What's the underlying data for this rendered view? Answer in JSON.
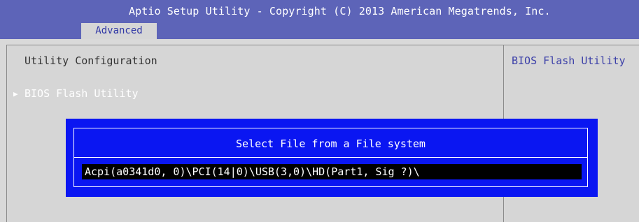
{
  "header": {
    "title": "Aptio Setup Utility - Copyright (C) 2013 American Megatrends, Inc.",
    "tabs": [
      {
        "label": "Advanced",
        "selected": true
      }
    ]
  },
  "main": {
    "section_title": "Utility Configuration",
    "items": [
      {
        "label": "BIOS Flash Utility",
        "selected": true,
        "submenu": true
      }
    ],
    "help_text": "BIOS Flash Utility"
  },
  "dialog": {
    "title": "Select File from a File system",
    "path_value": "Acpi(a0341d0, 0)\\PCI(14|0)\\USB(3,0)\\HD(Part1, Sig ?)\\"
  },
  "icons": {
    "submenu_arrow": "triangle-right-icon"
  },
  "colors": {
    "header_bg": "#5d64b8",
    "panel_bg": "#d6d6d6",
    "dialog_bg": "#0a16f2",
    "field_bg": "#000000",
    "text_light": "#ffffff",
    "tab_text": "#2f36a6",
    "help_text": "#3b3fa8"
  }
}
